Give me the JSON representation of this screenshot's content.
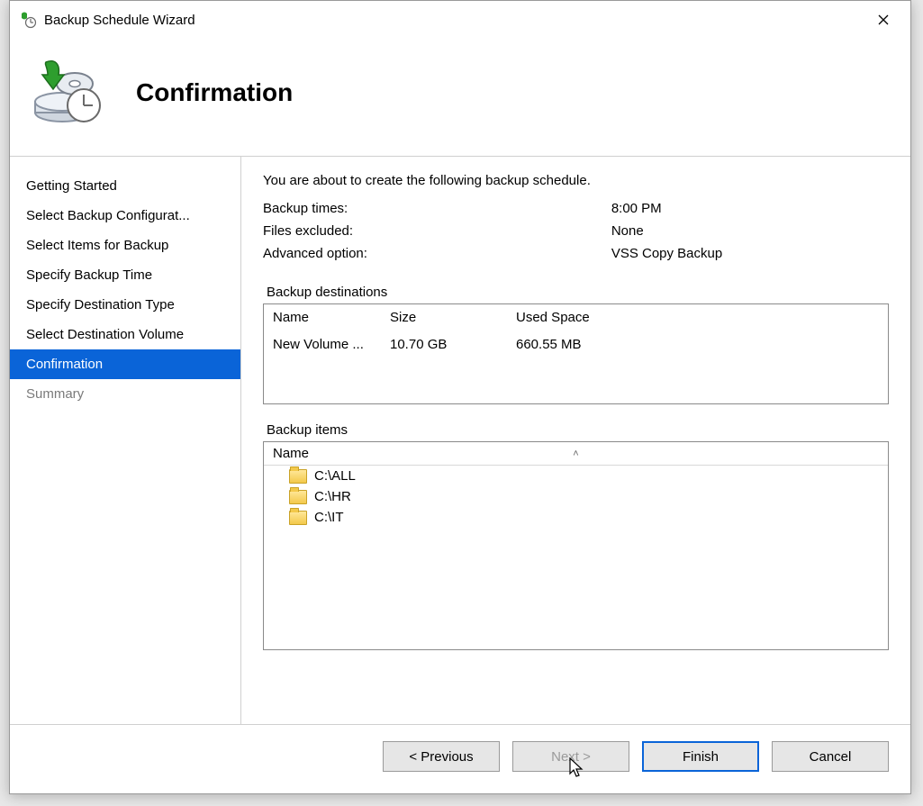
{
  "window": {
    "title": "Backup Schedule Wizard"
  },
  "header": {
    "page_title": "Confirmation"
  },
  "sidebar": {
    "items": [
      {
        "label": "Getting Started",
        "state": "past"
      },
      {
        "label": "Select Backup Configurat...",
        "state": "past"
      },
      {
        "label": "Select Items for Backup",
        "state": "past"
      },
      {
        "label": "Specify Backup Time",
        "state": "past"
      },
      {
        "label": "Specify Destination Type",
        "state": "past"
      },
      {
        "label": "Select Destination Volume",
        "state": "past"
      },
      {
        "label": "Confirmation",
        "state": "current"
      },
      {
        "label": "Summary",
        "state": "future"
      }
    ]
  },
  "content": {
    "intro": "You are about to create the following backup schedule.",
    "kv": [
      {
        "label": "Backup times:",
        "value": "8:00 PM"
      },
      {
        "label": "Files excluded:",
        "value": "None"
      },
      {
        "label": "Advanced option:",
        "value": "VSS Copy Backup"
      }
    ],
    "destinations": {
      "section_label": "Backup destinations",
      "columns": {
        "name": "Name",
        "size": "Size",
        "used": "Used Space"
      },
      "rows": [
        {
          "name": "New Volume ...",
          "size": "10.70 GB",
          "used": "660.55 MB"
        }
      ]
    },
    "items": {
      "section_label": "Backup items",
      "column": "Name",
      "rows": [
        {
          "path": "C:\\ALL"
        },
        {
          "path": "C:\\HR"
        },
        {
          "path": "C:\\IT"
        }
      ]
    }
  },
  "buttons": {
    "previous": "< Previous",
    "next": "Next >",
    "finish": "Finish",
    "cancel": "Cancel"
  }
}
